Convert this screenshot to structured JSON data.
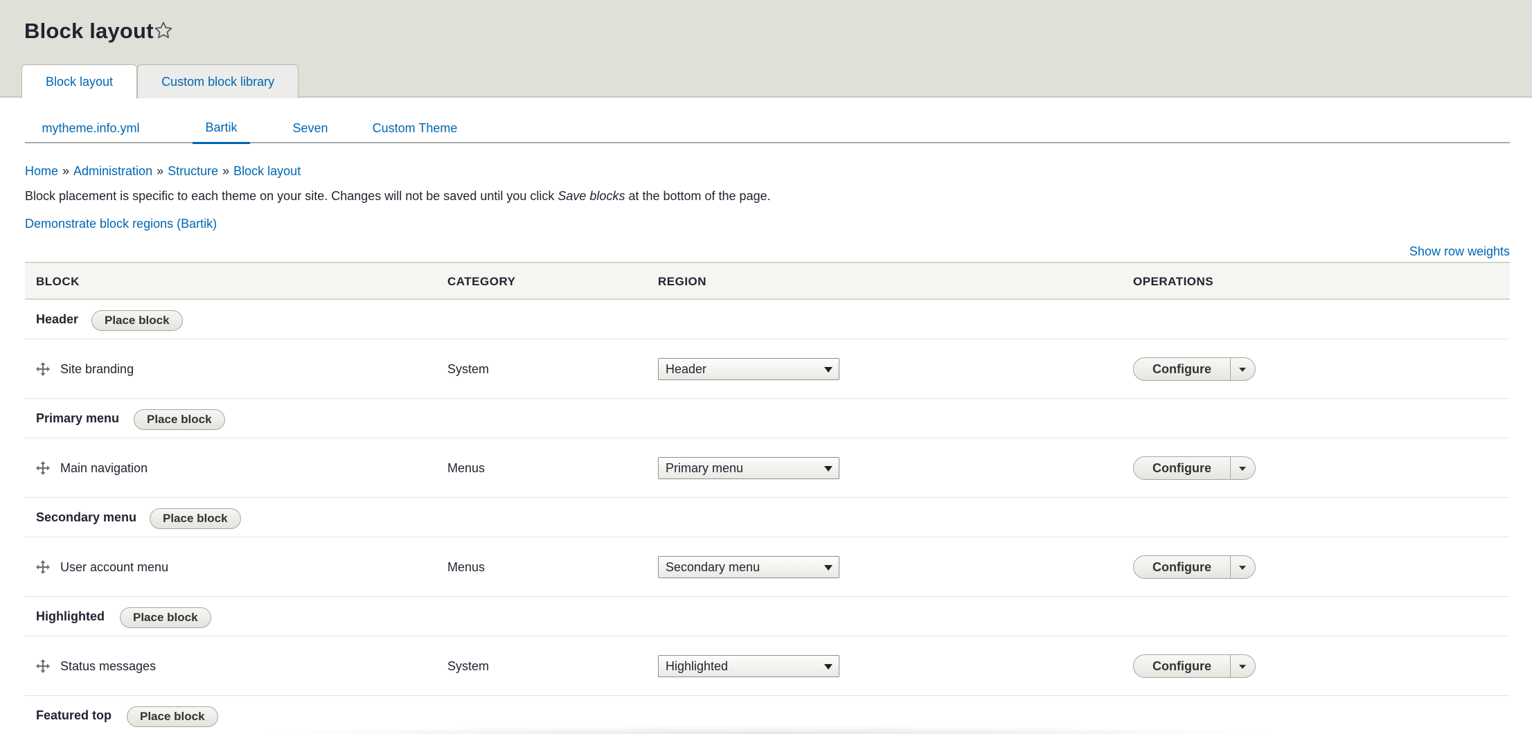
{
  "page": {
    "title": "Block layout",
    "star_icon": "star-outline-icon"
  },
  "primary_tabs": [
    {
      "label": "Block layout",
      "active": true
    },
    {
      "label": "Custom block library",
      "active": false
    }
  ],
  "secondary_tabs": [
    {
      "label": "mytheme.info.yml",
      "active": false
    },
    {
      "label": "Bartik",
      "active": true
    },
    {
      "label": "Seven",
      "active": false
    },
    {
      "label": "Custom Theme",
      "active": false
    }
  ],
  "breadcrumb": [
    "Home",
    "Administration",
    "Structure",
    "Block layout"
  ],
  "breadcrumb_separator": "»",
  "help": {
    "before": "Block placement is specific to each theme on your site. Changes will not be saved until you click ",
    "emphasis": "Save blocks",
    "after": " at the bottom of the page."
  },
  "demo_link": "Demonstrate block regions (Bartik)",
  "row_weights_link": "Show row weights",
  "table": {
    "headers": {
      "block": "BLOCK",
      "category": "CATEGORY",
      "region": "REGION",
      "operations": "OPERATIONS"
    },
    "place_block_label": "Place block",
    "configure_label": "Configure",
    "regions": [
      {
        "name": "Header",
        "blocks": [
          {
            "label": "Site branding",
            "category": "System",
            "region": "Header"
          }
        ]
      },
      {
        "name": "Primary menu",
        "blocks": [
          {
            "label": "Main navigation",
            "category": "Menus",
            "region": "Primary menu"
          }
        ]
      },
      {
        "name": "Secondary menu",
        "blocks": [
          {
            "label": "User account menu",
            "category": "Menus",
            "region": "Secondary menu"
          }
        ]
      },
      {
        "name": "Highlighted",
        "blocks": [
          {
            "label": "Status messages",
            "category": "System",
            "region": "Highlighted"
          }
        ]
      },
      {
        "name": "Featured top",
        "blocks": []
      }
    ]
  },
  "colors": {
    "link": "#0066b3",
    "header_bg": "#e0e0d8",
    "text": "#222330"
  }
}
